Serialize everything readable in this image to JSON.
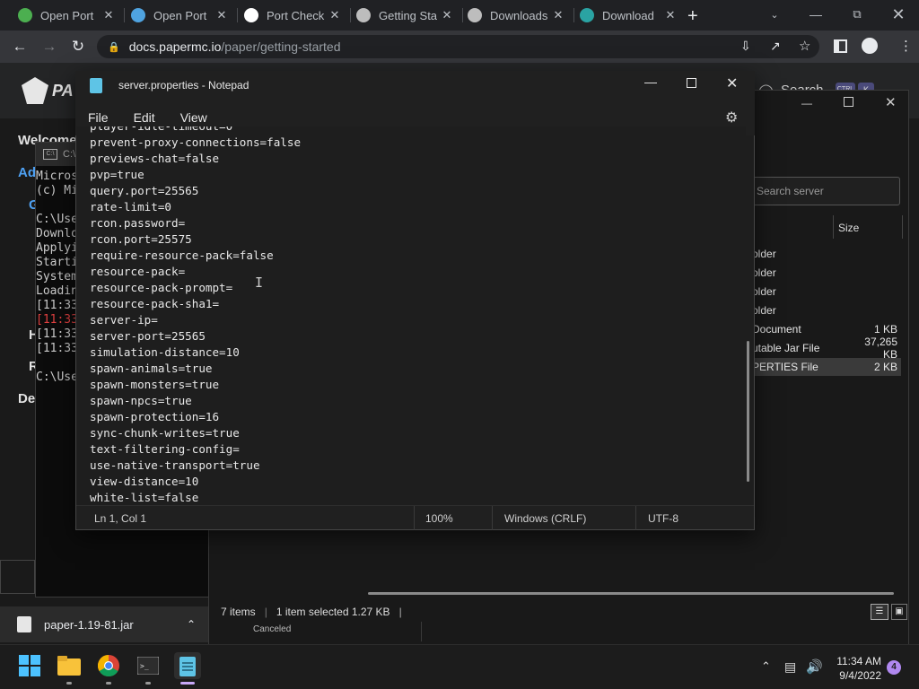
{
  "browser": {
    "tabs": [
      {
        "label": "Open Port",
        "color": "#4caf50"
      },
      {
        "label": "Open Port",
        "color": "#4fa3e0"
      },
      {
        "label": "Port Check",
        "color": "#ffffff"
      },
      {
        "label": "Getting Sta",
        "color": "#bdbdbd"
      },
      {
        "label": "Downloads",
        "color": "#bdbdbd"
      },
      {
        "label": "Download",
        "color": "#2aa3a3"
      }
    ],
    "url_host": "docs.papermc.io",
    "url_path": "/paper/getting-started",
    "page": {
      "logo_text": "PA",
      "search_text": "Search",
      "search_key1": "CTRL",
      "search_key2": "K",
      "sidebar": [
        "Welcome",
        "Ad",
        "G",
        "H",
        "R",
        "De"
      ]
    }
  },
  "console": {
    "title": "C:\\",
    "lines": [
      "Micros",
      "(c) Mi",
      "",
      "C:\\Use",
      "Downlo",
      "Applyi",
      "Starti",
      "System",
      "Loadin",
      "[11:33",
      "[11:33",
      "[11:33",
      "[11:33",
      "",
      "C:\\Use"
    ]
  },
  "explorer": {
    "search_placeholder": "Search server",
    "size_header": "Size",
    "rows": [
      {
        "name": "older",
        "size": ""
      },
      {
        "name": "older",
        "size": ""
      },
      {
        "name": "older",
        "size": ""
      },
      {
        "name": "older",
        "size": ""
      },
      {
        "name": "Document",
        "size": "1 KB"
      },
      {
        "name": "utable Jar File",
        "size": "37,265 KB"
      },
      {
        "name": "PERTIES File",
        "size": "2 KB"
      }
    ],
    "status_items": "7 items",
    "status_selected": "1 item selected  1.27 KB",
    "download_canceled": "Canceled"
  },
  "notepad": {
    "title": "server.properties - Notepad",
    "menu": [
      "File",
      "Edit",
      "View"
    ],
    "lines": [
      "player-idle-timeout=0",
      "prevent-proxy-connections=false",
      "previews-chat=false",
      "pvp=true",
      "query.port=25565",
      "rate-limit=0",
      "rcon.password=",
      "rcon.port=25575",
      "require-resource-pack=false",
      "resource-pack=",
      "resource-pack-prompt=",
      "resource-pack-sha1=",
      "server-ip=",
      "server-port=25565",
      "simulation-distance=10",
      "spawn-animals=true",
      "spawn-monsters=true",
      "spawn-npcs=true",
      "spawn-protection=16",
      "sync-chunk-writes=true",
      "text-filtering-config=",
      "use-native-transport=true",
      "view-distance=10",
      "white-list=false"
    ],
    "status": {
      "position": "Ln 1, Col 1",
      "zoom": "100%",
      "line_ending": "Windows (CRLF)",
      "encoding": "UTF-8"
    }
  },
  "download_bar": {
    "file": "paper-1.19-81.jar"
  },
  "taskbar": {
    "time": "11:34 AM",
    "date": "9/4/2022",
    "notifications": "4"
  },
  "colors": {
    "accent": "#2b88d8",
    "chrome_bg": "#202124"
  }
}
